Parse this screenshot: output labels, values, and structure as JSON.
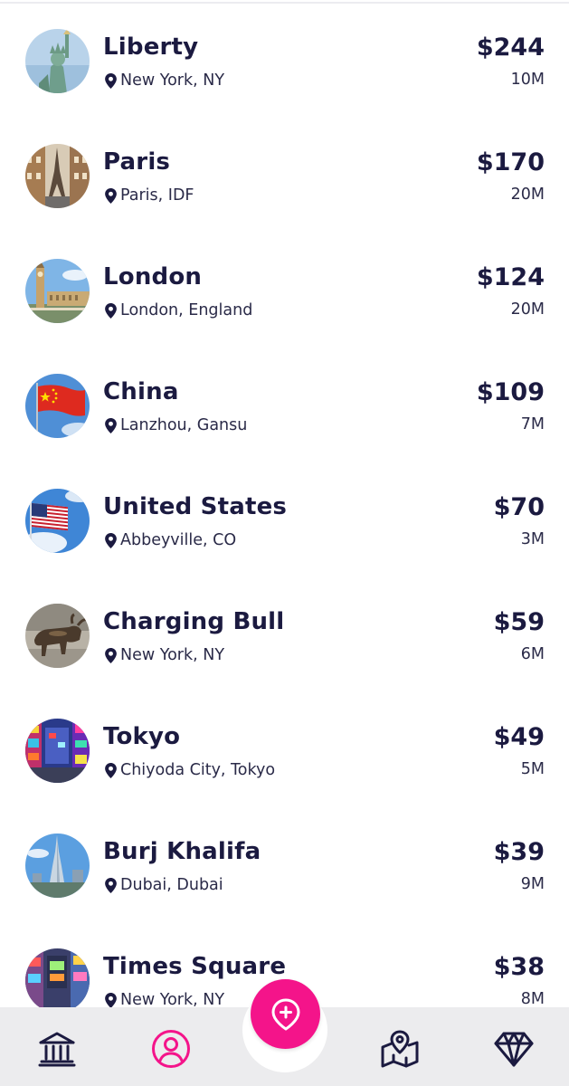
{
  "places": [
    {
      "name": "Liberty",
      "location": "New York, NY",
      "price": "$244",
      "count": "10M",
      "image": "statue-of-liberty-photo"
    },
    {
      "name": "Paris",
      "location": "Paris, IDF",
      "price": "$170",
      "count": "20M",
      "image": "eiffel-tower-street-photo"
    },
    {
      "name": "London",
      "location": "London, England",
      "price": "$124",
      "count": "20M",
      "image": "big-ben-westminster-photo"
    },
    {
      "name": "China",
      "location": "Lanzhou, Gansu",
      "price": "$109",
      "count": "7M",
      "image": "chinese-flag-photo"
    },
    {
      "name": "United States",
      "location": "Abbeyville, CO",
      "price": "$70",
      "count": "3M",
      "image": "us-flag-photo"
    },
    {
      "name": "Charging Bull",
      "location": "New York, NY",
      "price": "$59",
      "count": "6M",
      "image": "charging-bull-statue-photo"
    },
    {
      "name": "Tokyo",
      "location": "Chiyoda City, Tokyo",
      "price": "$49",
      "count": "5M",
      "image": "tokyo-street-night-photo"
    },
    {
      "name": "Burj Khalifa",
      "location": "Dubai, Dubai",
      "price": "$39",
      "count": "9M",
      "image": "burj-khalifa-photo"
    },
    {
      "name": "Times Square",
      "location": "New York, NY",
      "price": "$38",
      "count": "8M",
      "image": "times-square-photo"
    }
  ],
  "nav": {
    "items": [
      {
        "icon": "bank-icon",
        "active": false
      },
      {
        "icon": "profile-icon",
        "active": true
      },
      {
        "icon": "add-location-icon",
        "active": false
      },
      {
        "icon": "map-pin-icon",
        "active": false
      },
      {
        "icon": "diamond-icon",
        "active": false
      }
    ]
  },
  "colors": {
    "text": "#1b1a40",
    "accent": "#f4148a",
    "navbar": "#ececee",
    "background": "#ffffff"
  }
}
